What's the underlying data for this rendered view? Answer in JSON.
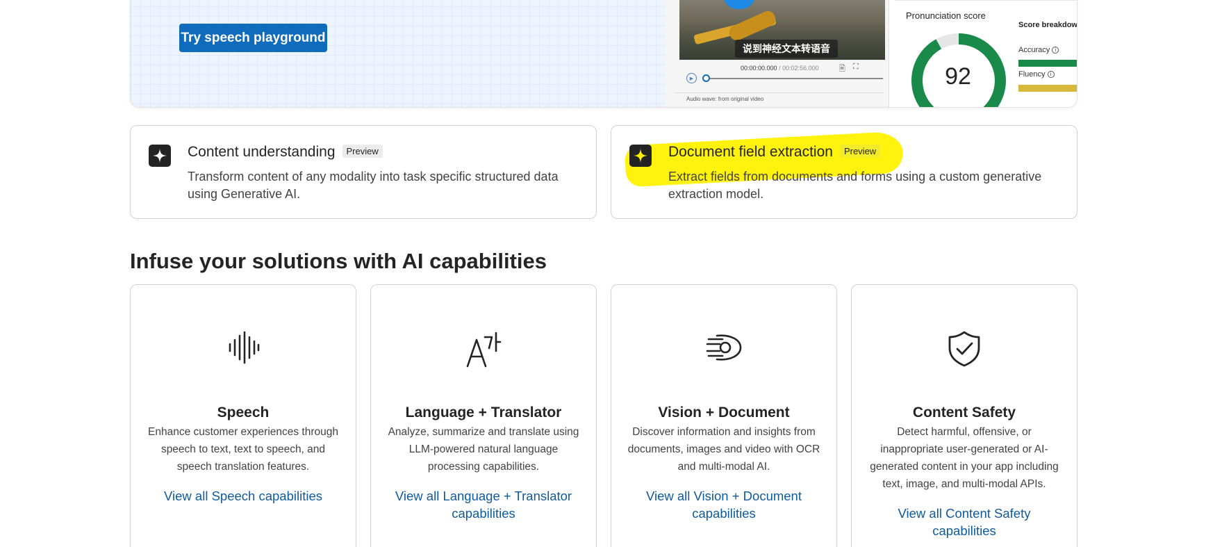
{
  "hero": {
    "button_label": "Try speech playground",
    "video": {
      "subtitle": "说到神经文本转语音",
      "time_current": "00:00:00.000",
      "time_separator": " / ",
      "time_total": "00:02:56.000",
      "audio_wave_label": "Audio wave: from original video"
    },
    "pronunciation": {
      "title": "Pronunciation score",
      "score": "92",
      "score_fraction": 0.92,
      "breakdown_title": "Score breakdown",
      "metrics": [
        {
          "label": "Accuracy",
          "color": "#1a8a4a"
        },
        {
          "label": "Fluency",
          "color": "#d6b93a"
        }
      ]
    }
  },
  "features": [
    {
      "title": "Content understanding",
      "badge": "Preview",
      "description": "Transform content of any modality into task specific structured data using Generative AI.",
      "icon": "sparkle-icon",
      "highlighted": false
    },
    {
      "title": "Document field extraction",
      "badge": "Preview",
      "description": "Extract fields from documents and forms using a custom generative extraction model.",
      "icon": "sparkle-icon",
      "highlighted": true
    }
  ],
  "capabilities_section": {
    "heading": "Infuse your solutions with AI capabilities",
    "cards": [
      {
        "title": "Speech",
        "description": "Enhance customer experiences through speech to text, text to speech, and speech translation features.",
        "link": "View all Speech capabilities",
        "icon": "soundwave-icon"
      },
      {
        "title": "Language + Translator",
        "description": "Analyze, summarize and translate using LLM-powered natural language processing capabilities.",
        "link": "View all Language + Translator capabilities",
        "icon": "translate-icon"
      },
      {
        "title": "Vision + Document",
        "description": "Discover information and insights from documents, images and video with OCR and multi-modal AI.",
        "link": "View all Vision + Document capabilities",
        "icon": "eye-scan-icon"
      },
      {
        "title": "Content Safety",
        "description": "Detect harmful, offensive, or inappropriate user-generated or AI-generated content in your app including text, image, and multi-modal APIs.",
        "link": "View all Content Safety capabilities",
        "icon": "shield-check-icon"
      }
    ]
  },
  "colors": {
    "primary": "#0f6cbd",
    "link": "#0f5a9c",
    "highlight": "#fff200",
    "score_green": "#1a8a4a",
    "score_track": "#e6e6e6"
  }
}
